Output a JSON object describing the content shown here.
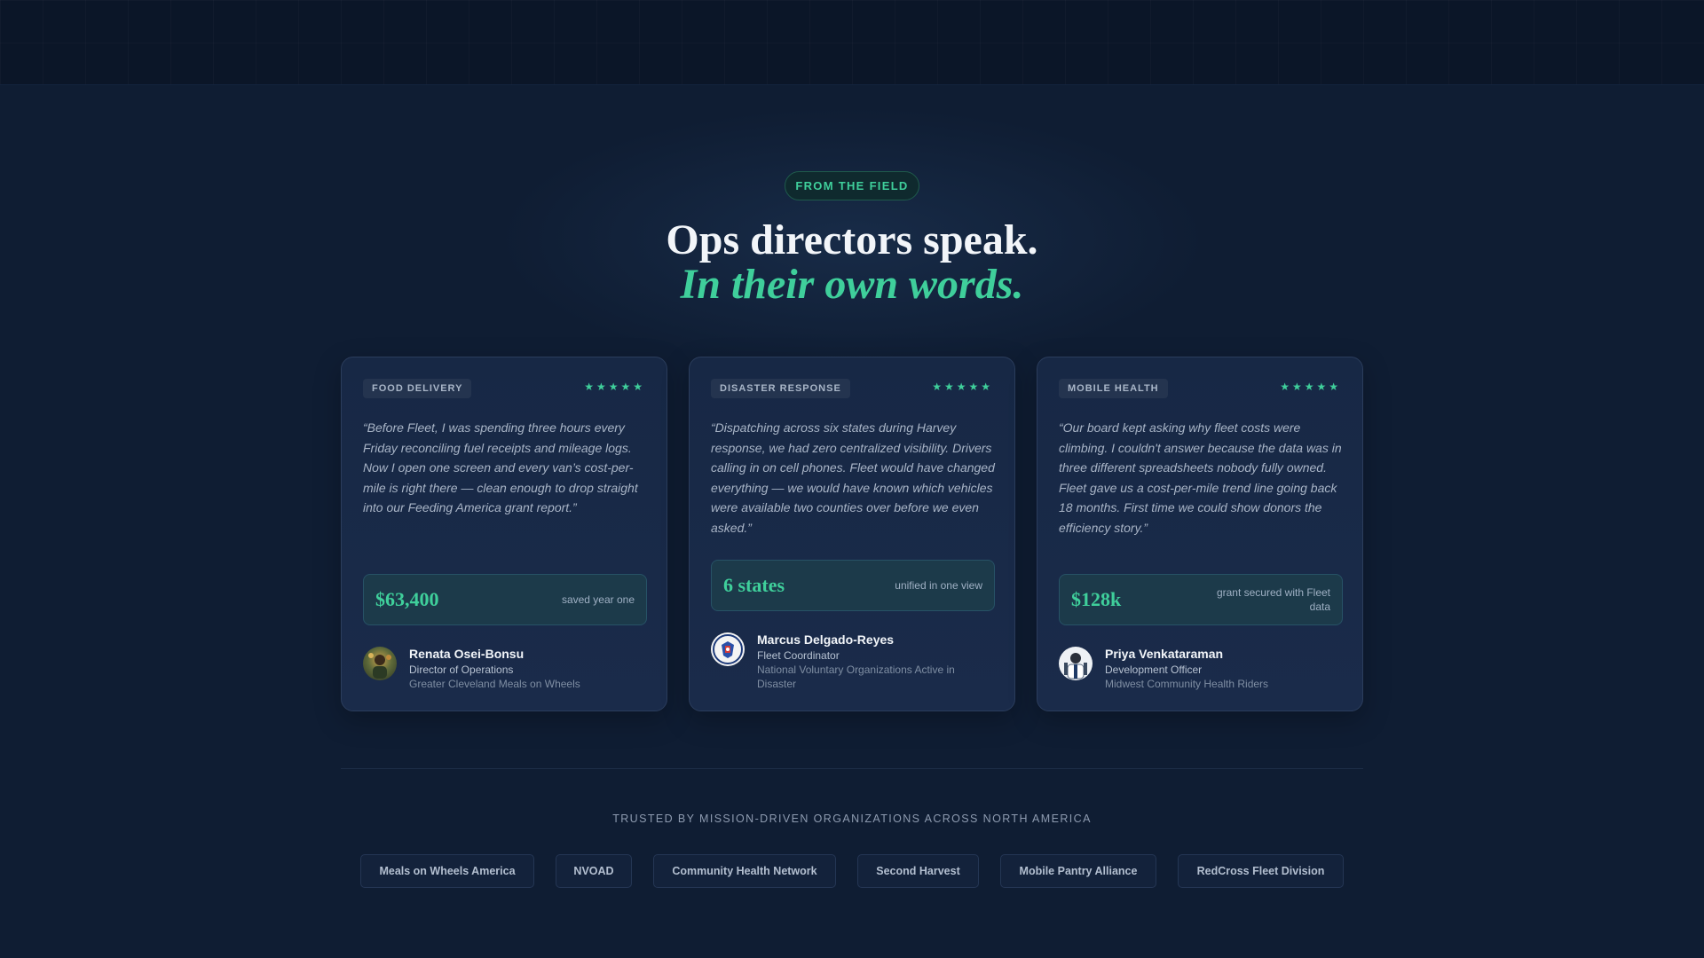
{
  "section": {
    "eyebrow": "FROM THE FIELD",
    "headline_line1": "Ops directors speak.",
    "headline_line2": "In their own words."
  },
  "testimonials": [
    {
      "tag": "FOOD DELIVERY",
      "rating": "★★★★★",
      "quote": "“Before Fleet, I was spending three hours every Friday reconciling fuel receipts and mileage logs. Now I open one screen and every van’s cost-per-mile is right there — clean enough to drop straight into our Feeding America grant report.”",
      "metric_value": "$63,400",
      "metric_note": "saved year one",
      "name": "Renata Osei-Bonsu",
      "role": "Director of Operations",
      "org": "Greater Cleveland Meals on Wheels"
    },
    {
      "tag": "DISASTER RESPONSE",
      "rating": "★★★★★",
      "quote": "“Dispatching across six states during Harvey response, we had zero centralized visibility. Drivers calling in on cell phones. Fleet would have changed everything — we would have known which vehicles were available two counties over before we even asked.”",
      "metric_value": "6 states",
      "metric_note": "unified in one view",
      "name": "Marcus Delgado-Reyes",
      "role": "Fleet Coordinator",
      "org": "National Voluntary Organizations Active in Disaster"
    },
    {
      "tag": "MOBILE HEALTH",
      "rating": "★★★★★",
      "quote": "“Our board kept asking why fleet costs were climbing. I couldn't answer because the data was in three different spreadsheets nobody fully owned. Fleet gave us a cost-per-mile trend line going back 18 months. First time we could show donors the efficiency story.”",
      "metric_value": "$128k",
      "metric_note": "grant secured with Fleet data",
      "name": "Priya Venkataraman",
      "role": "Development Officer",
      "org": "Midwest Community Health Riders"
    }
  ],
  "trusted": {
    "label": "TRUSTED BY MISSION-DRIVEN ORGANIZATIONS ACROSS NORTH AMERICA",
    "logos": [
      "Meals on Wheels America",
      "NVOAD",
      "Community Health Network",
      "Second Harvest",
      "Mobile Pantry Alliance",
      "RedCross Fleet Division"
    ]
  },
  "colors": {
    "accent": "#3fcf9b",
    "background": "#0f1d33",
    "card": "#1a2b4a"
  },
  "icons": {
    "rating": "star-icon",
    "avatars": [
      "avatar-photo-renata",
      "avatar-photo-marcus",
      "avatar-photo-priya"
    ]
  }
}
